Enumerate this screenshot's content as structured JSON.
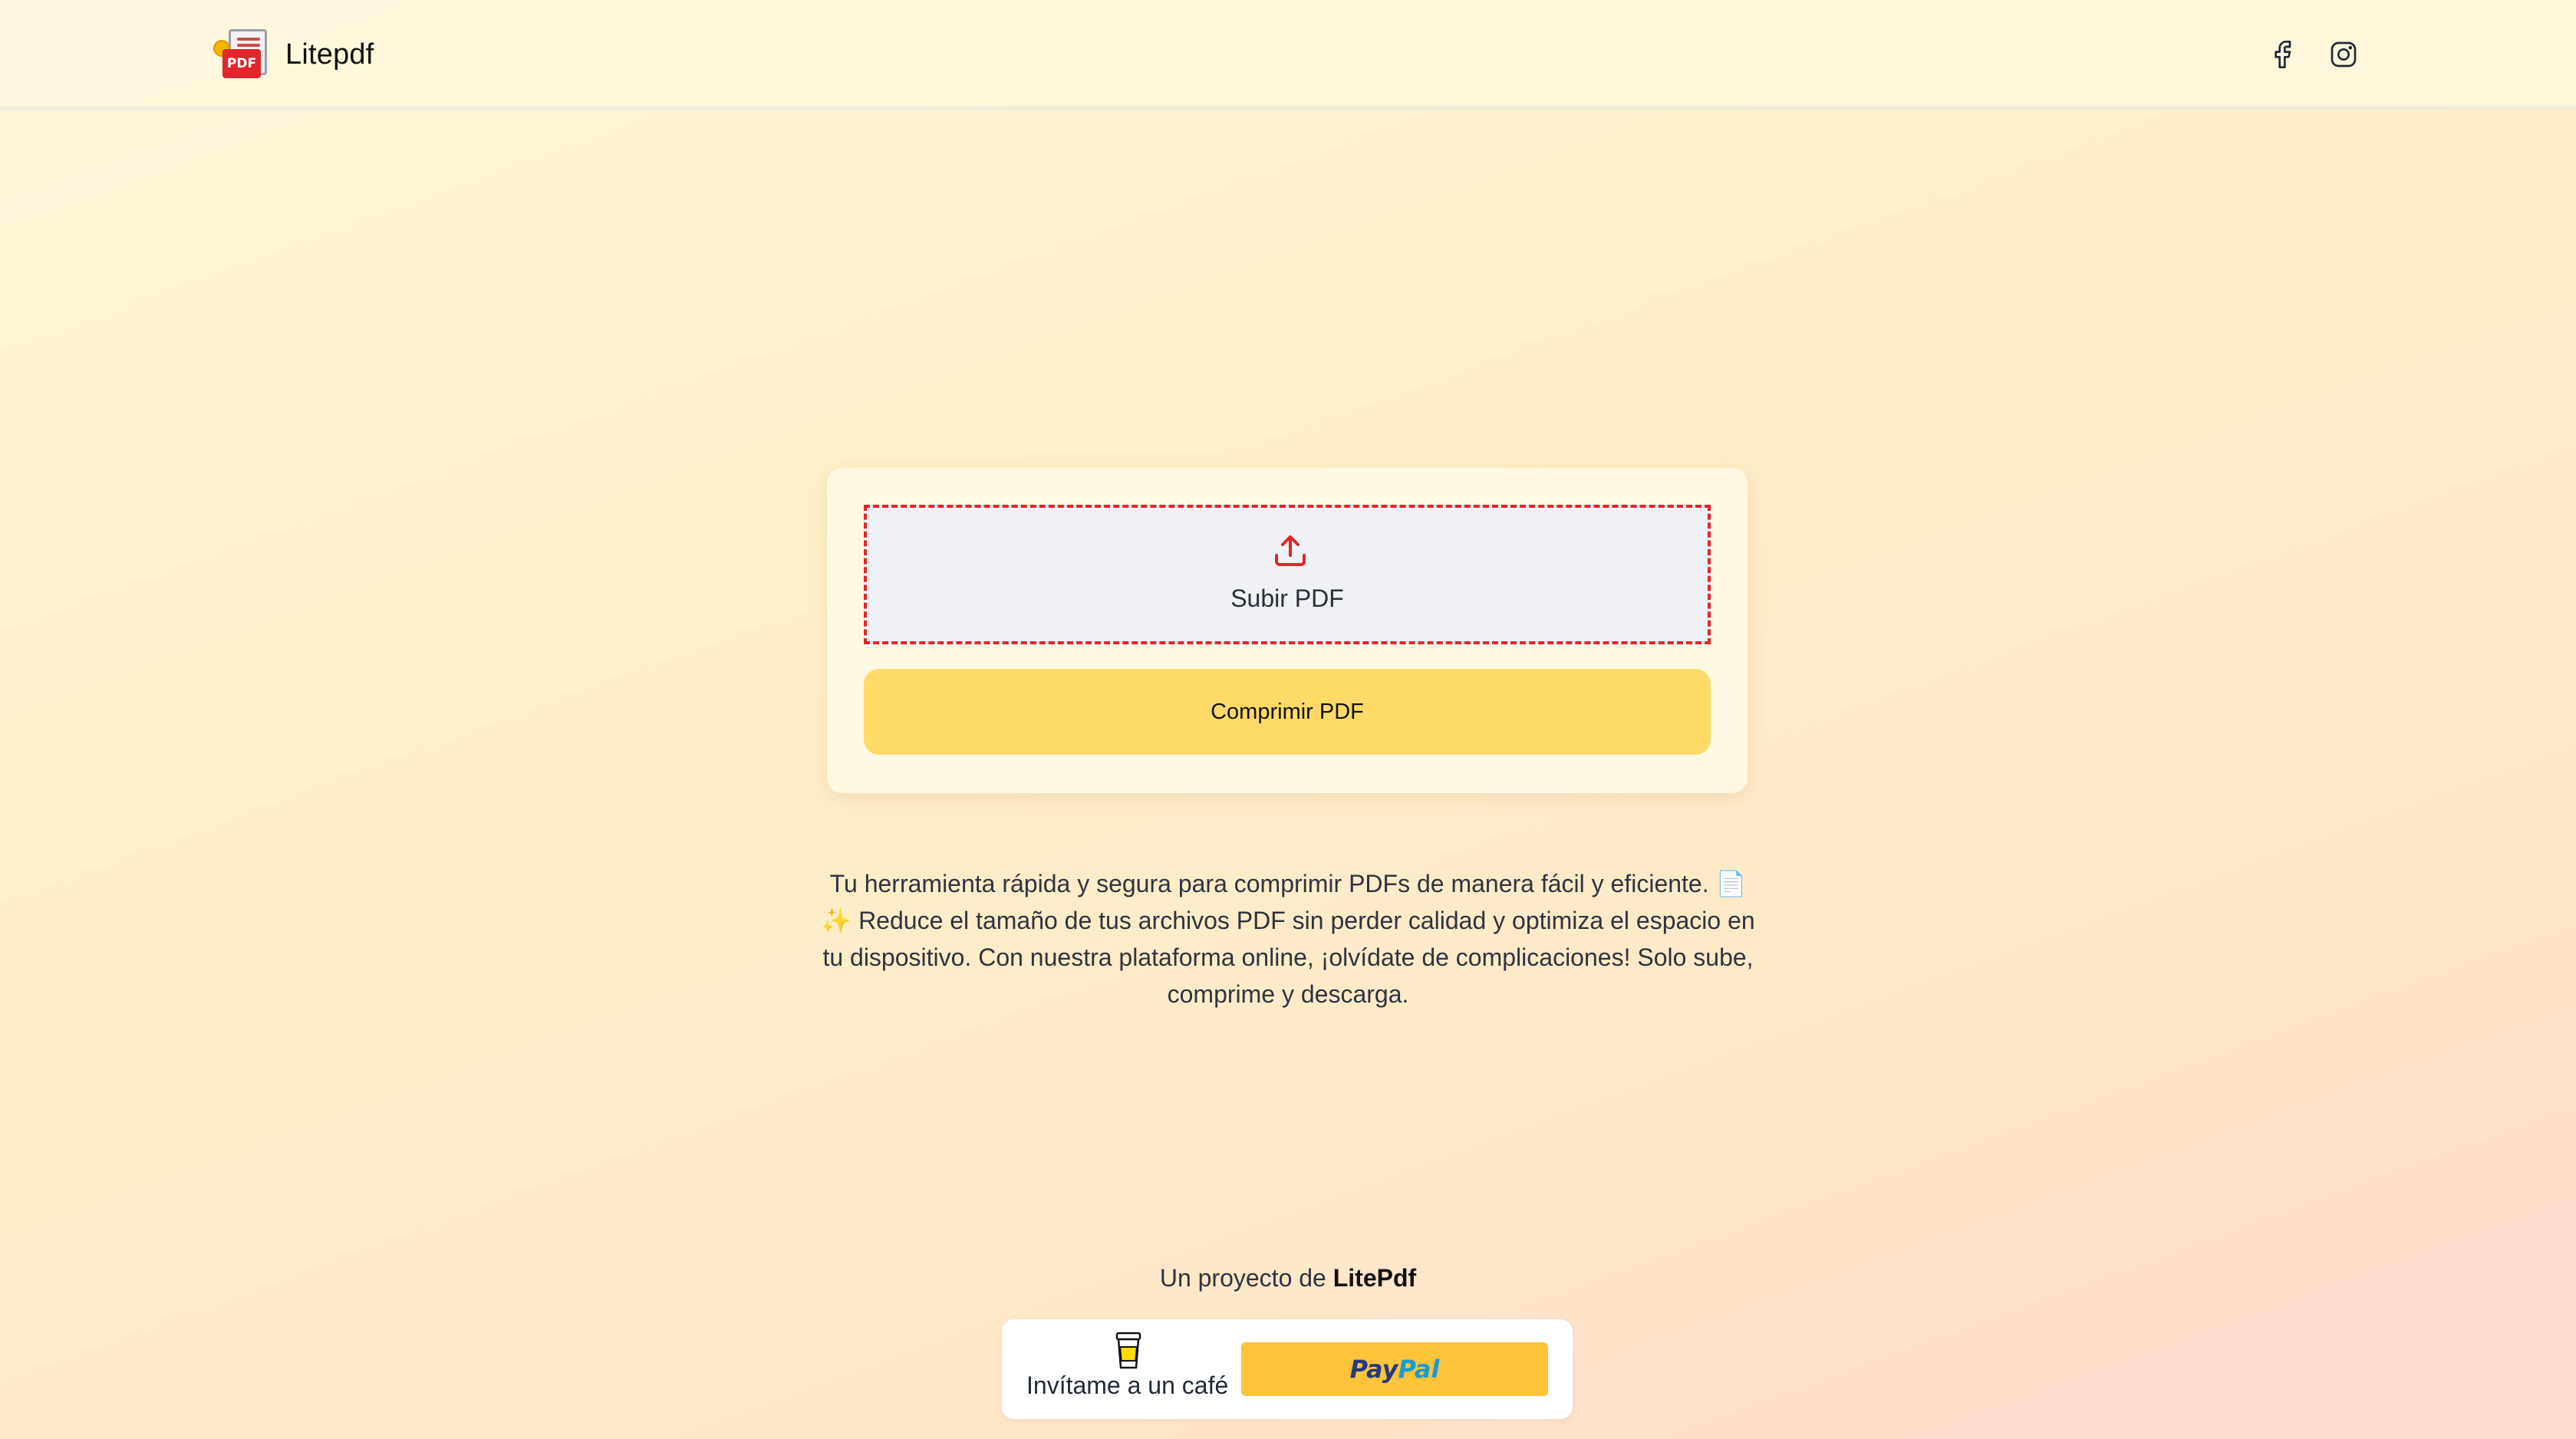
{
  "header": {
    "brand_name": "Litepdf",
    "logo_badge": "PDF",
    "social": [
      {
        "icon": "facebook-icon"
      },
      {
        "icon": "instagram-icon"
      }
    ]
  },
  "upload": {
    "icon": "upload-icon",
    "label": "Subir PDF",
    "accent_color": "#e0262b"
  },
  "compress_button": {
    "label": "Comprimir PDF",
    "color": "#ffda66"
  },
  "description": "Tu herramienta rápida y segura para comprimir PDFs de manera fácil y eficiente. 📄✨ Reduce el tamaño de tus archivos PDF sin perder calidad y optimiza el espacio en tu dispositivo. Con nuestra plataforma online, ¡olvídate de complicaciones! Solo sube, comprime y descarga.",
  "footer": {
    "credit_prefix": "Un proyecto de",
    "credit_name": "LitePdf",
    "coffee_icon": "coffee-cup-icon",
    "coffee_label": "Invítame a un café",
    "paypal_pay": "Pay",
    "paypal_pal": "Pal",
    "paypal_color": "#ffc43a"
  }
}
